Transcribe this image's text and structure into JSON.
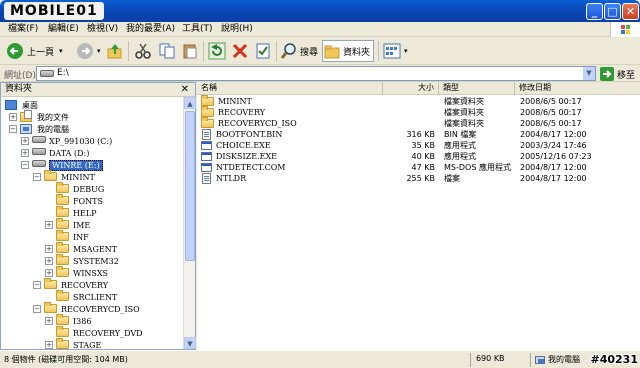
{
  "title_bar": {
    "logo_text": "MOBILE01"
  },
  "menu": [
    "檔案(F)",
    "編輯(E)",
    "檢視(V)",
    "我的最愛(A)",
    "工具(T)",
    "說明(H)"
  ],
  "toolbar": {
    "back_label": "上一頁",
    "search_label": "搜尋",
    "folders_label": "資料夾"
  },
  "address": {
    "label": "網址(D)",
    "value": "E:\\",
    "go_label": "移至"
  },
  "folder_pane": {
    "title": "資料夾",
    "close_glyph": "✕"
  },
  "tree": [
    {
      "label": "桌面"
    },
    {
      "label": "我的文件"
    },
    {
      "label": "我的電腦"
    },
    {
      "label": "XP_991030 (C:)"
    },
    {
      "label": "DATA (D:)"
    },
    {
      "label": "WINRE (E:)"
    },
    {
      "label": "MININT"
    },
    {
      "label": "DEBUG"
    },
    {
      "label": "FONTS"
    },
    {
      "label": "HELP"
    },
    {
      "label": "IME"
    },
    {
      "label": "INF"
    },
    {
      "label": "MSAGENT"
    },
    {
      "label": "SYSTEM32"
    },
    {
      "label": "WINSXS"
    },
    {
      "label": "RECOVERY"
    },
    {
      "label": "SRCLIENT"
    },
    {
      "label": "RECOVERYCD_ISO"
    },
    {
      "label": "I386"
    },
    {
      "label": "RECOVERY_DVD"
    },
    {
      "label": "STAGE"
    }
  ],
  "columns": {
    "name": "名稱",
    "size": "大小",
    "type": "類型",
    "modified": "修改日期"
  },
  "files": [
    {
      "name": "MININT",
      "size": "",
      "type": "檔案資料夾",
      "modified": "2008/6/5 00:17",
      "icon": "folder"
    },
    {
      "name": "RECOVERY",
      "size": "",
      "type": "檔案資料夾",
      "modified": "2008/6/5 00:17",
      "icon": "folder"
    },
    {
      "name": "RECOVERYCD_ISO",
      "size": "",
      "type": "檔案資料夾",
      "modified": "2008/6/5 00:17",
      "icon": "folder"
    },
    {
      "name": "BOOTFONT.BIN",
      "size": "316 KB",
      "type": "BIN 檔案",
      "modified": "2004/8/17 12:00",
      "icon": "file"
    },
    {
      "name": "CHOICE.EXE",
      "size": "35 KB",
      "type": "應用程式",
      "modified": "2003/3/24 17:46",
      "icon": "exe"
    },
    {
      "name": "DISKSIZE.EXE",
      "size": "40 KB",
      "type": "應用程式",
      "modified": "2005/12/16 07:23",
      "icon": "exe"
    },
    {
      "name": "NTDETECT.COM",
      "size": "47 KB",
      "type": "MS-DOS 應用程式",
      "modified": "2004/8/17 12:00",
      "icon": "exe"
    },
    {
      "name": "NTLDR",
      "size": "255 KB",
      "type": "檔案",
      "modified": "2004/8/17 12:00",
      "icon": "file"
    }
  ],
  "status": {
    "objects": "8 個物件 (磁碟可用空間: 104 MB)",
    "size": "690 KB",
    "location": "我的電腦",
    "watermark": "#40231"
  }
}
